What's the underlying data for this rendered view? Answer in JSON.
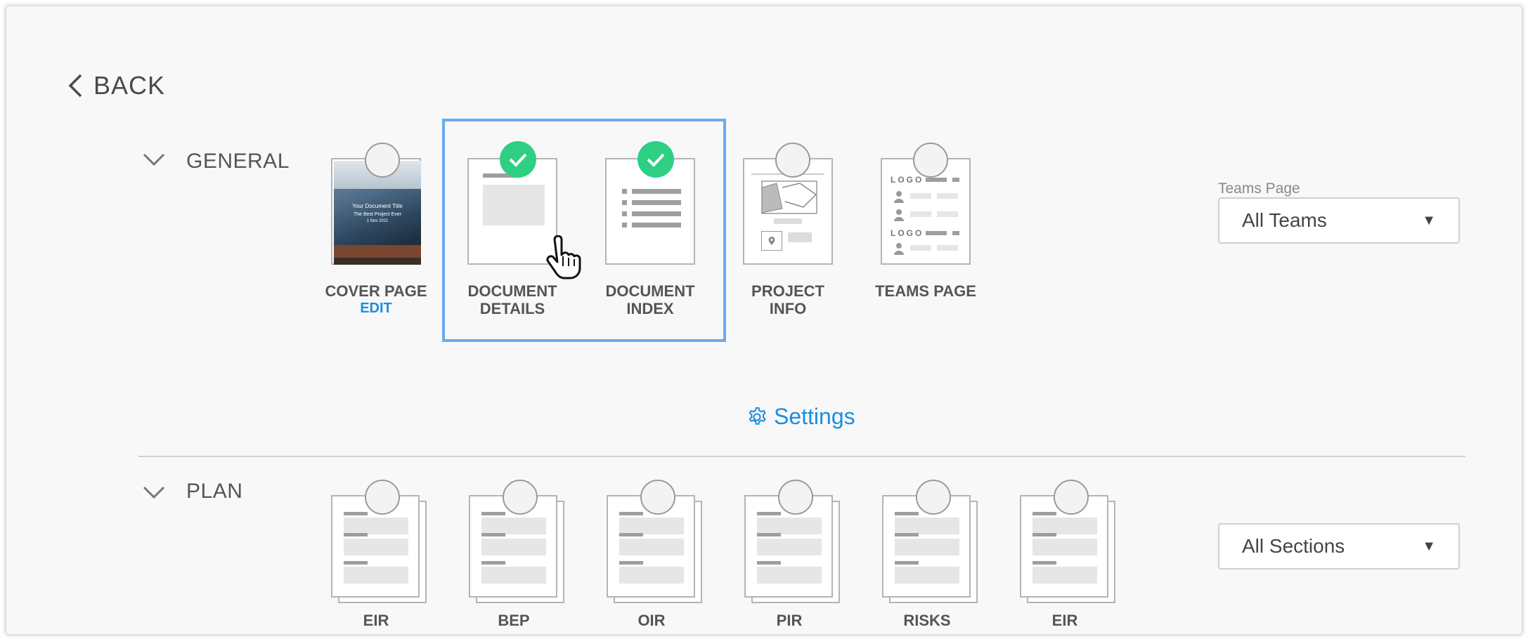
{
  "back": {
    "label": "BACK"
  },
  "general": {
    "title": "GENERAL",
    "cards": [
      {
        "line1": "COVER PAGE",
        "line2": "",
        "selected": false,
        "edit": "EDIT"
      },
      {
        "line1": "DOCUMENT",
        "line2": "DETAILS",
        "selected": true
      },
      {
        "line1": "DOCUMENT",
        "line2": "INDEX",
        "selected": true
      },
      {
        "line1": "PROJECT",
        "line2": "INFO",
        "selected": false
      },
      {
        "line1": "TEAMS PAGE",
        "line2": "",
        "selected": false
      }
    ],
    "cover_text": {
      "title": "Your Document Title",
      "subtitle": "The Best Project Ever",
      "date": "1 Nov 2021"
    },
    "teams_logo": "LOGO",
    "teams_dropdown": {
      "label": "Teams Page",
      "value": "All Teams"
    }
  },
  "settings": {
    "label": "Settings"
  },
  "plan": {
    "title": "PLAN",
    "cards": [
      "EIR",
      "BEP",
      "OIR",
      "PIR",
      "RISKS",
      "EIR"
    ],
    "sections_dropdown": {
      "value": "All Sections"
    }
  },
  "colors": {
    "accent": "#1a8ee0",
    "check": "#2ecf82",
    "selection": "#6aaaf0"
  }
}
